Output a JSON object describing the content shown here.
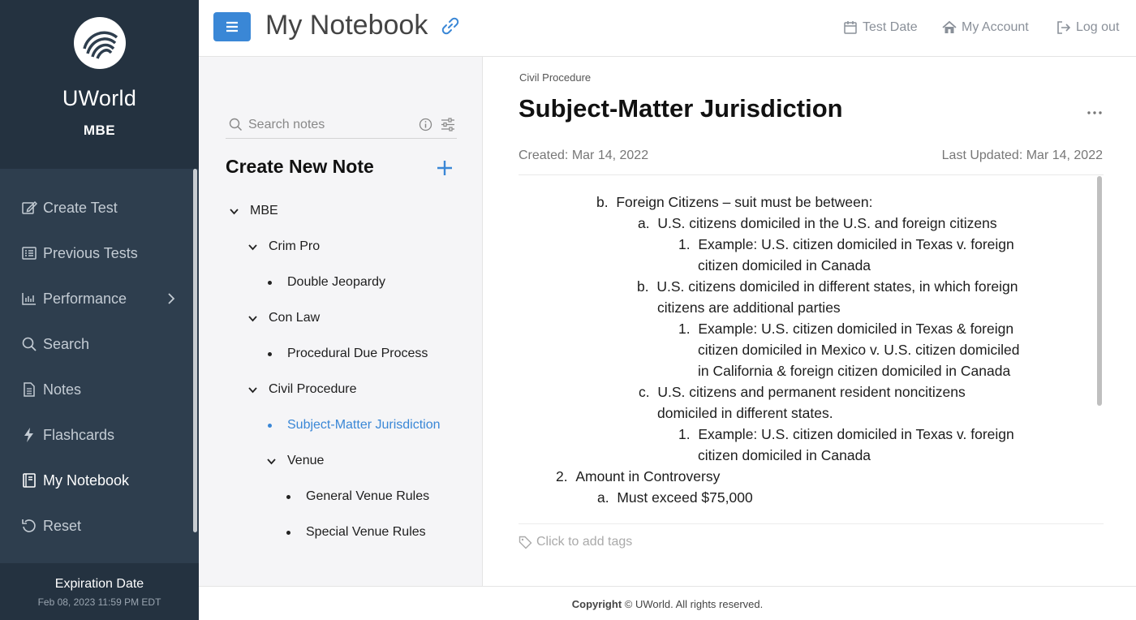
{
  "sidebar": {
    "brand_name": "UWorld",
    "brand_sub": "MBE",
    "items": [
      {
        "label": "Create Test",
        "icon": "edit-icon"
      },
      {
        "label": "Previous Tests",
        "icon": "list-icon"
      },
      {
        "label": "Performance",
        "icon": "bar-chart-icon"
      },
      {
        "label": "Search",
        "icon": "search-icon"
      },
      {
        "label": "Notes",
        "icon": "document-icon"
      },
      {
        "label": "Flashcards",
        "icon": "bolt-icon"
      },
      {
        "label": "My Notebook",
        "icon": "notebook-icon"
      },
      {
        "label": "Reset",
        "icon": "reset-icon"
      }
    ],
    "active_item": "My Notebook",
    "expiry_title": "Expiration Date",
    "expiry_date": "Feb 08, 2023 11:59 PM EDT"
  },
  "header": {
    "title": "My Notebook",
    "test_date": "Test Date",
    "my_account": "My Account",
    "log_out": "Log out"
  },
  "notes_panel": {
    "search_placeholder": "Search notes",
    "create_label": "Create New Note",
    "tree": [
      {
        "label": "MBE",
        "type": "folder"
      },
      {
        "label": "Crim Pro",
        "type": "folder"
      },
      {
        "label": "Double Jeopardy",
        "type": "note"
      },
      {
        "label": "Con Law",
        "type": "folder"
      },
      {
        "label": "Procedural Due Process",
        "type": "note"
      },
      {
        "label": "Civil Procedure",
        "type": "folder"
      },
      {
        "label": "Subject-Matter Jurisdiction",
        "type": "note",
        "active": true
      },
      {
        "label": "Venue",
        "type": "folder"
      },
      {
        "label": "General Venue Rules",
        "type": "note"
      },
      {
        "label": "Special Venue Rules",
        "type": "note"
      }
    ]
  },
  "note": {
    "breadcrumb": "Civil Procedure",
    "title": "Subject-Matter Jurisdiction",
    "created": "Created: Mar 14, 2022",
    "updated": "Last Updated: Mar 14, 2022",
    "lines": [
      {
        "marker": "b.",
        "text": "Foreign Citizens – suit must be between:"
      },
      {
        "marker": "a.",
        "text": "U.S. citizens domiciled in the U.S. and foreign citizens"
      },
      {
        "marker": "1.",
        "text": "Example:  U.S. citizen domiciled in Texas v. foreign"
      },
      {
        "marker": "",
        "text": "citizen domiciled in Canada"
      },
      {
        "marker": "b.",
        "text": "U.S. citizens domiciled in different states, in which foreign"
      },
      {
        "marker": "",
        "text": "citizens are additional parties"
      },
      {
        "marker": "1.",
        "text": "Example:  U.S. citizen domiciled in Texas & foreign"
      },
      {
        "marker": "",
        "text": "citizen domiciled in Mexico v. U.S. citizen domiciled"
      },
      {
        "marker": "",
        "text": "in California & foreign citizen domiciled in Canada"
      },
      {
        "marker": "c.",
        "text": "U.S. citizens and permanent resident noncitizens"
      },
      {
        "marker": "",
        "text": "domiciled in different states."
      },
      {
        "marker": "1.",
        "text": "Example:  U.S. citizen domiciled in Texas v. foreign"
      },
      {
        "marker": "",
        "text": "citizen domiciled in Canada"
      },
      {
        "marker": "2.",
        "text": "Amount in Controversy"
      },
      {
        "marker": "a.",
        "text": "Must exceed $75,000"
      }
    ],
    "tags_placeholder": "Click to add tags"
  },
  "footer": {
    "bold": "Copyright",
    "text": "© UWorld. All rights reserved."
  }
}
